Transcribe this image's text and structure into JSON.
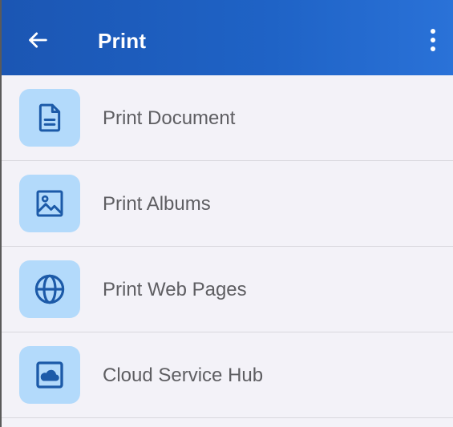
{
  "appbar": {
    "title": "Print",
    "back_icon": "arrow-left-icon",
    "more_icon": "more-vert-icon",
    "background": "#1f63c6"
  },
  "menu": {
    "items": [
      {
        "label": "Print Document",
        "icon": "document-icon"
      },
      {
        "label": "Print Albums",
        "icon": "image-icon"
      },
      {
        "label": "Print Web Pages",
        "icon": "globe-icon"
      },
      {
        "label": "Cloud Service Hub",
        "icon": "cloud-icon"
      }
    ],
    "icon_tile_color": "#b3dafb",
    "icon_color": "#1c5aa8"
  }
}
